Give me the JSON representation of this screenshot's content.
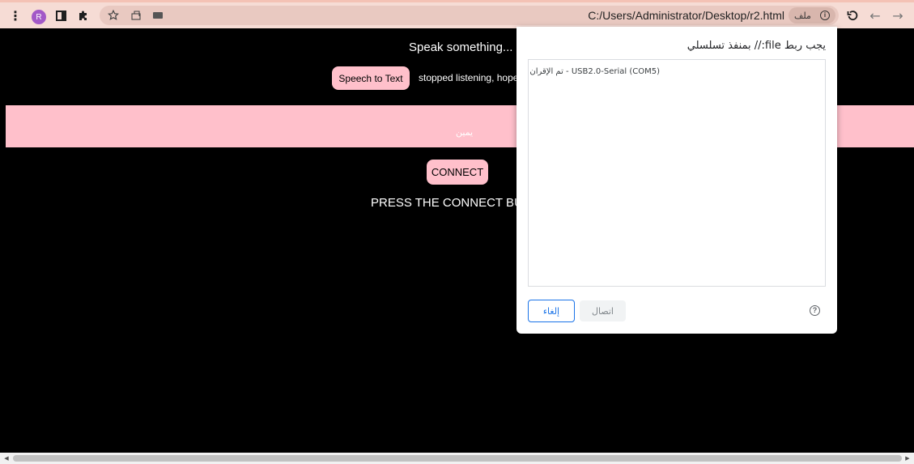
{
  "browser": {
    "url": "C:/Users/Administrator/Desktop/r2.html",
    "file_chip_label": "ملف",
    "profile_initial": "R",
    "icons": {
      "menu": "vertical-dots-icon",
      "side_panel": "side-panel-icon",
      "extensions": "puzzle-icon",
      "bookmark": "star-icon",
      "reload": "reload-icon",
      "back": "back-arrow-icon",
      "forward": "forward-arrow-icon"
    }
  },
  "page": {
    "title": "Speak something...",
    "speech_button": "Speech to Text",
    "status": "stopped listening, hope",
    "band_text": "يمين",
    "connect_button": "CONNECT",
    "instruction": "PRESS THE CONNECT BUT"
  },
  "dialog": {
    "title": "يجب ربط file:// بمنفذ تسلسلي",
    "ports": [
      "USB2.0-Serial (COM5) - تم الإقران"
    ],
    "connect_label": "اتصال",
    "cancel_label": "إلغاء"
  },
  "colors": {
    "accent_pink": "#ffc0cb",
    "toolbar": "#f6dcd5",
    "dialog_primary": "#1a73e8"
  }
}
